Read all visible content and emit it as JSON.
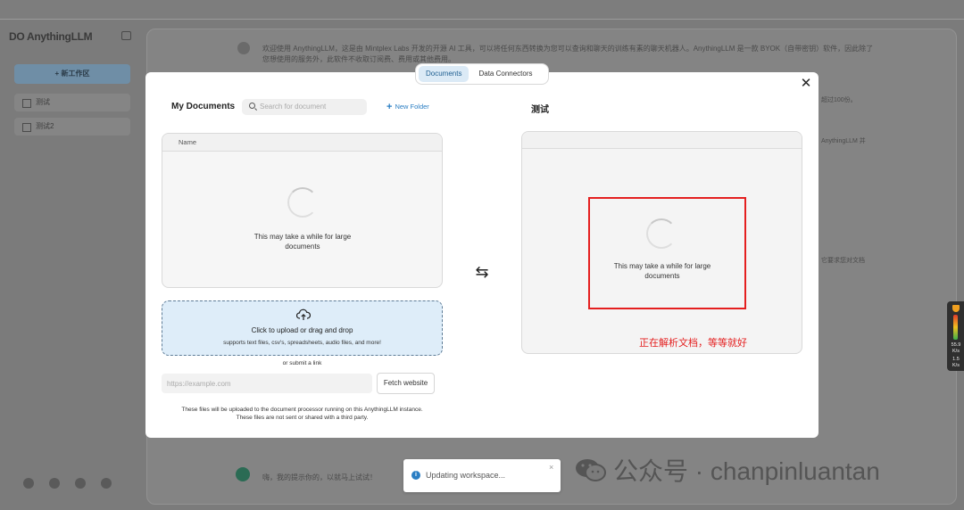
{
  "app": {
    "logo": "DO AnythingLLM",
    "new_workspace_label": "+ 新工作区",
    "workspaces": [
      "测试",
      "测试2"
    ]
  },
  "background_chat": {
    "intro_line1": "欢迎使用 AnythingLLM，这是由 Mintplex Labs 开发的开源 AI 工具，可以将任何东西转换为您可以查询和聊天的训练有素的聊天机器人。AnythingLLM 是一款 BYOK（自带密钥）软件，因此除了",
    "intro_line2": "您想使用的服务外，此软件不收取订阅费、费用或其他费用。",
    "right_snippet1": "超过100份。",
    "right_snippet2": "AnythingLLM 并",
    "right_snippet3": "它要求您对文档",
    "bottom_message": "嗨，我的提示你的，以就马上试试！"
  },
  "modal": {
    "tabs": [
      {
        "label": "Documents",
        "active": true
      },
      {
        "label": "Data Connectors",
        "active": false
      }
    ],
    "my_documents_title": "My Documents",
    "search_placeholder": "Search for document",
    "new_folder_label": "New Folder",
    "workspace_title": "测试",
    "doc_table_header": "Name",
    "loading_text": "This may take a while for large documents",
    "upload_title": "Click to upload or drag and drop",
    "upload_subtitle": "supports text files, csv's, spreadsheets, audio files, and more!",
    "or_submit_link": "or submit a link",
    "url_placeholder": "https://example.com",
    "fetch_button": "Fetch website",
    "disclaimer_line1": "These files will be uploaded to the document processor running on this AnythingLLM instance.",
    "disclaimer_line2": "These files are not sent or shared with a third party.",
    "ws_loading_text": "This may take a while for large documents"
  },
  "annotation": {
    "text": "正在解析文档，等等就好",
    "color": "#e41f1f"
  },
  "toast": {
    "text": "Updating workspace...",
    "close": "×"
  },
  "watermark": {
    "text": "公众号 · chanpinluantan"
  },
  "side_widget": {
    "value1": "55.9",
    "rate1": "K/s",
    "value2": "1.5",
    "rate2": "K/s"
  },
  "colors": {
    "accent": "#2a7ec3",
    "tab_active_bg": "#dbeaf6",
    "upload_bg": "#deedf9",
    "overlay": "#7b7b7b"
  }
}
